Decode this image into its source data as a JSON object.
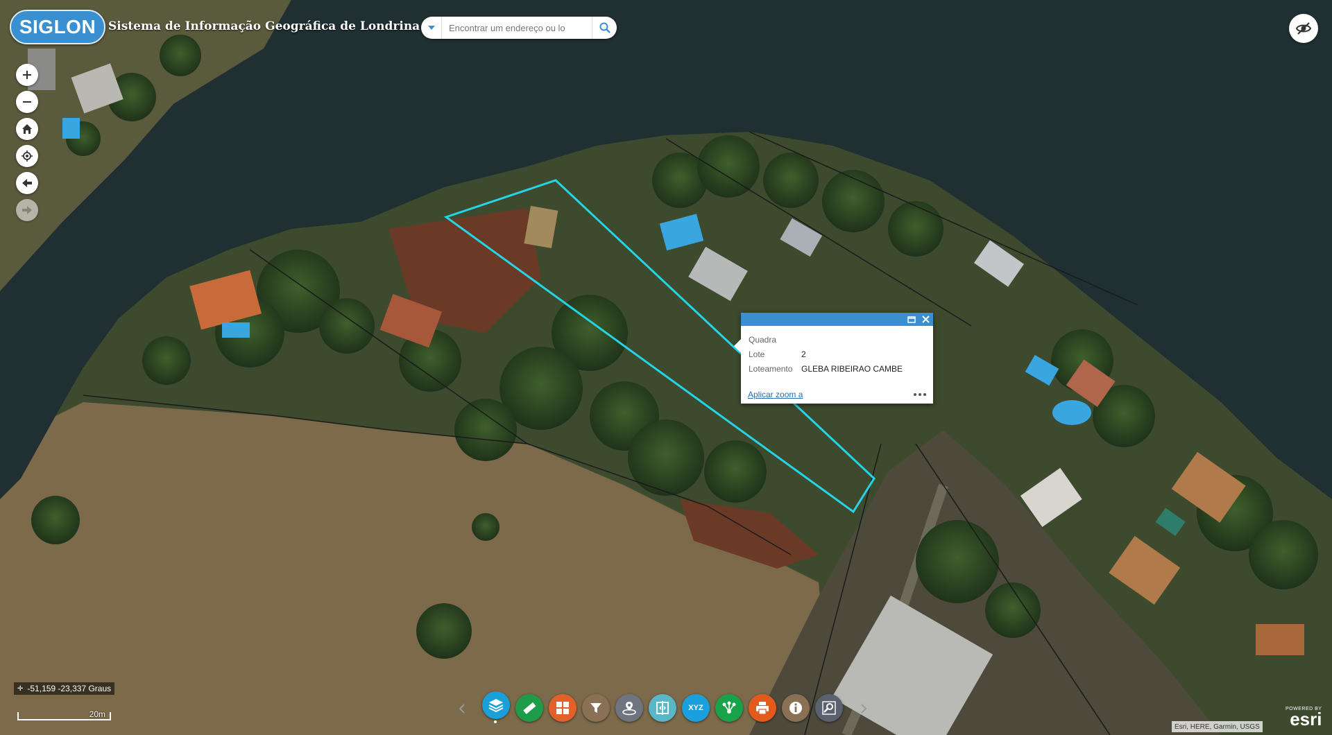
{
  "header": {
    "logo_text": "SIGLON",
    "title": "Sistema de Informação Geográfica de Londrina",
    "search": {
      "placeholder": "Encontrar um endereço ou lo",
      "value": ""
    }
  },
  "map": {
    "icons": {
      "zoom_in": "plus-icon",
      "zoom_out": "minus-icon",
      "home": "home-icon",
      "locate": "locate-icon",
      "back": "arrow-left-icon",
      "forward": "arrow-right-icon",
      "visibility": "eye-off-icon"
    },
    "highlight_color": "#23d5e6"
  },
  "popup": {
    "fields": [
      {
        "key": "Quadra",
        "value": ""
      },
      {
        "key": "Lote",
        "value": "2"
      },
      {
        "key": "Loteamento",
        "value": "GLEBA RIBEIRAO CAMBE"
      }
    ],
    "zoom_link": "Aplicar zoom a",
    "accent": "#3a8fd0"
  },
  "toolbar": {
    "tools": [
      {
        "name": "layers",
        "color": "#1a9fd8"
      },
      {
        "name": "measure",
        "color": "#1f9c4a"
      },
      {
        "name": "basemap-gallery",
        "color": "#e0622a"
      },
      {
        "name": "filter",
        "color": "#8a7155"
      },
      {
        "name": "location",
        "color": "#6e7580"
      },
      {
        "name": "swipe",
        "color": "#5ab7c8"
      },
      {
        "name": "xyz",
        "color": "#1aa0dc"
      },
      {
        "name": "share",
        "color": "#18a24a"
      },
      {
        "name": "print",
        "color": "#e25a1c"
      },
      {
        "name": "about",
        "color": "#8a7155"
      },
      {
        "name": "search-zoom",
        "color": "#5a6270"
      }
    ],
    "xyz_label": "XYZ"
  },
  "status": {
    "coordinates": "-51,159 -23,337 Graus",
    "scale_label": "20m",
    "attribution": "Esri, HERE, Garmin, USGS",
    "powered_by": "POWERED BY",
    "esri": "esri"
  }
}
